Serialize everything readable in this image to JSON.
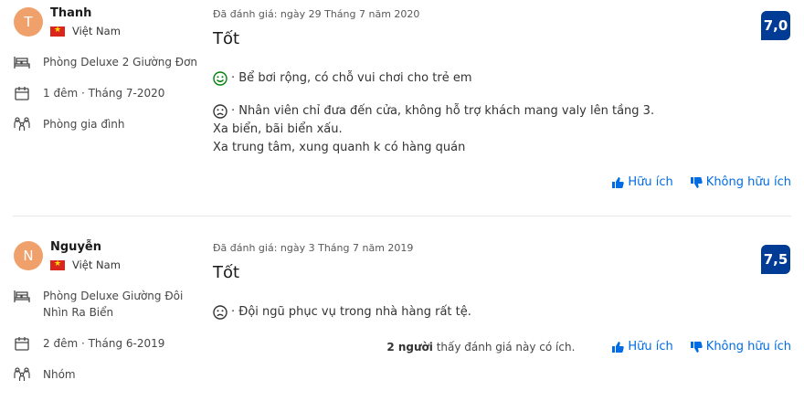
{
  "reviews": [
    {
      "avatar_letter": "T",
      "name": "Thanh",
      "country": "Việt Nam",
      "room": "Phòng Deluxe 2 Giường Đơn",
      "stay": "1 đêm · Tháng 7-2020",
      "group": "Phòng gia đình",
      "date": "Đã đánh giá: ngày 29 Tháng 7 năm 2020",
      "title": "Tốt",
      "liked": "· Bể bơi rộng, có chỗ vui chơi cho trẻ em",
      "disliked": "· Nhân viên chỉ đưa đến cửa, không hỗ trợ khách mang valy lên tầng 3.",
      "disliked_extra": [
        "Xa biển, bãi biển xấu.",
        "Xa trung tâm, xung quanh k có hàng quán"
      ],
      "score": "7,0"
    },
    {
      "avatar_letter": "N",
      "name": "Nguyễn",
      "country": "Việt Nam",
      "room": "Phòng Deluxe Giường Đôi Nhìn Ra Biển",
      "stay": "2 đêm · Tháng 6-2019",
      "group": "Nhóm",
      "date": "Đã đánh giá: ngày 3 Tháng 7 năm 2019",
      "title": "Tốt",
      "disliked": "· Đội ngũ phục vụ trong nhà hàng rất tệ.",
      "helpful_count": "2 người",
      "helpful_suffix": " thấy đánh giá này có ích.",
      "score": "7,5"
    }
  ],
  "actions": {
    "helpful": "Hữu ích",
    "not_helpful": "Không hữu ích"
  },
  "colors": {
    "accent": "#006ce4",
    "score_bg": "#003b95",
    "avatar_bg": "#f0a06b",
    "liked_face": "#008009"
  }
}
